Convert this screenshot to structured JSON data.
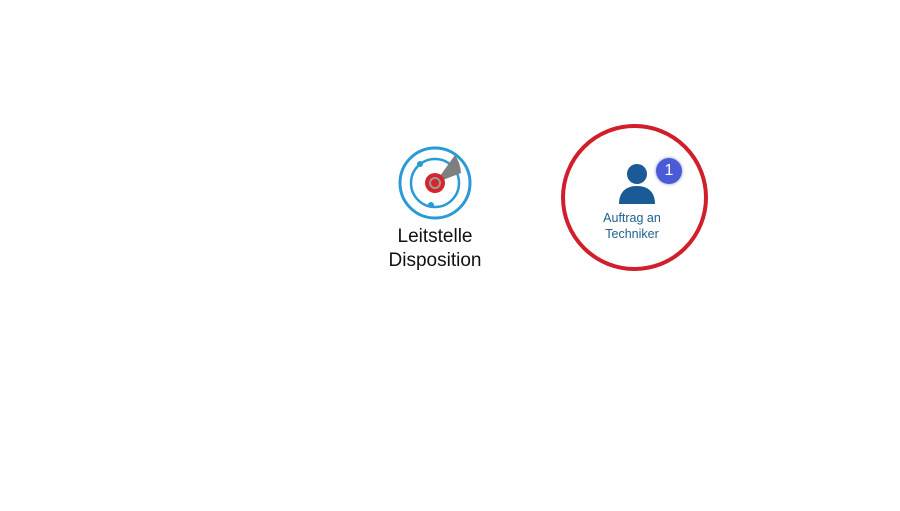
{
  "tiles": {
    "leitstelle": {
      "label_line1": "Leitstelle",
      "label_line2": "Disposition",
      "icon": "radar-icon"
    },
    "auftrag": {
      "label_line1": "Auftrag an",
      "label_line2": "Techniker",
      "icon": "user-icon",
      "badge_count": "1"
    }
  },
  "colors": {
    "highlight_ring": "#d01f2b",
    "badge": "#4b5bd6",
    "user_icon": "#1a5a96",
    "radar_ring": "#2a9ad6",
    "radar_center": "#d4262c",
    "auftrag_label": "#1f5f8f"
  }
}
